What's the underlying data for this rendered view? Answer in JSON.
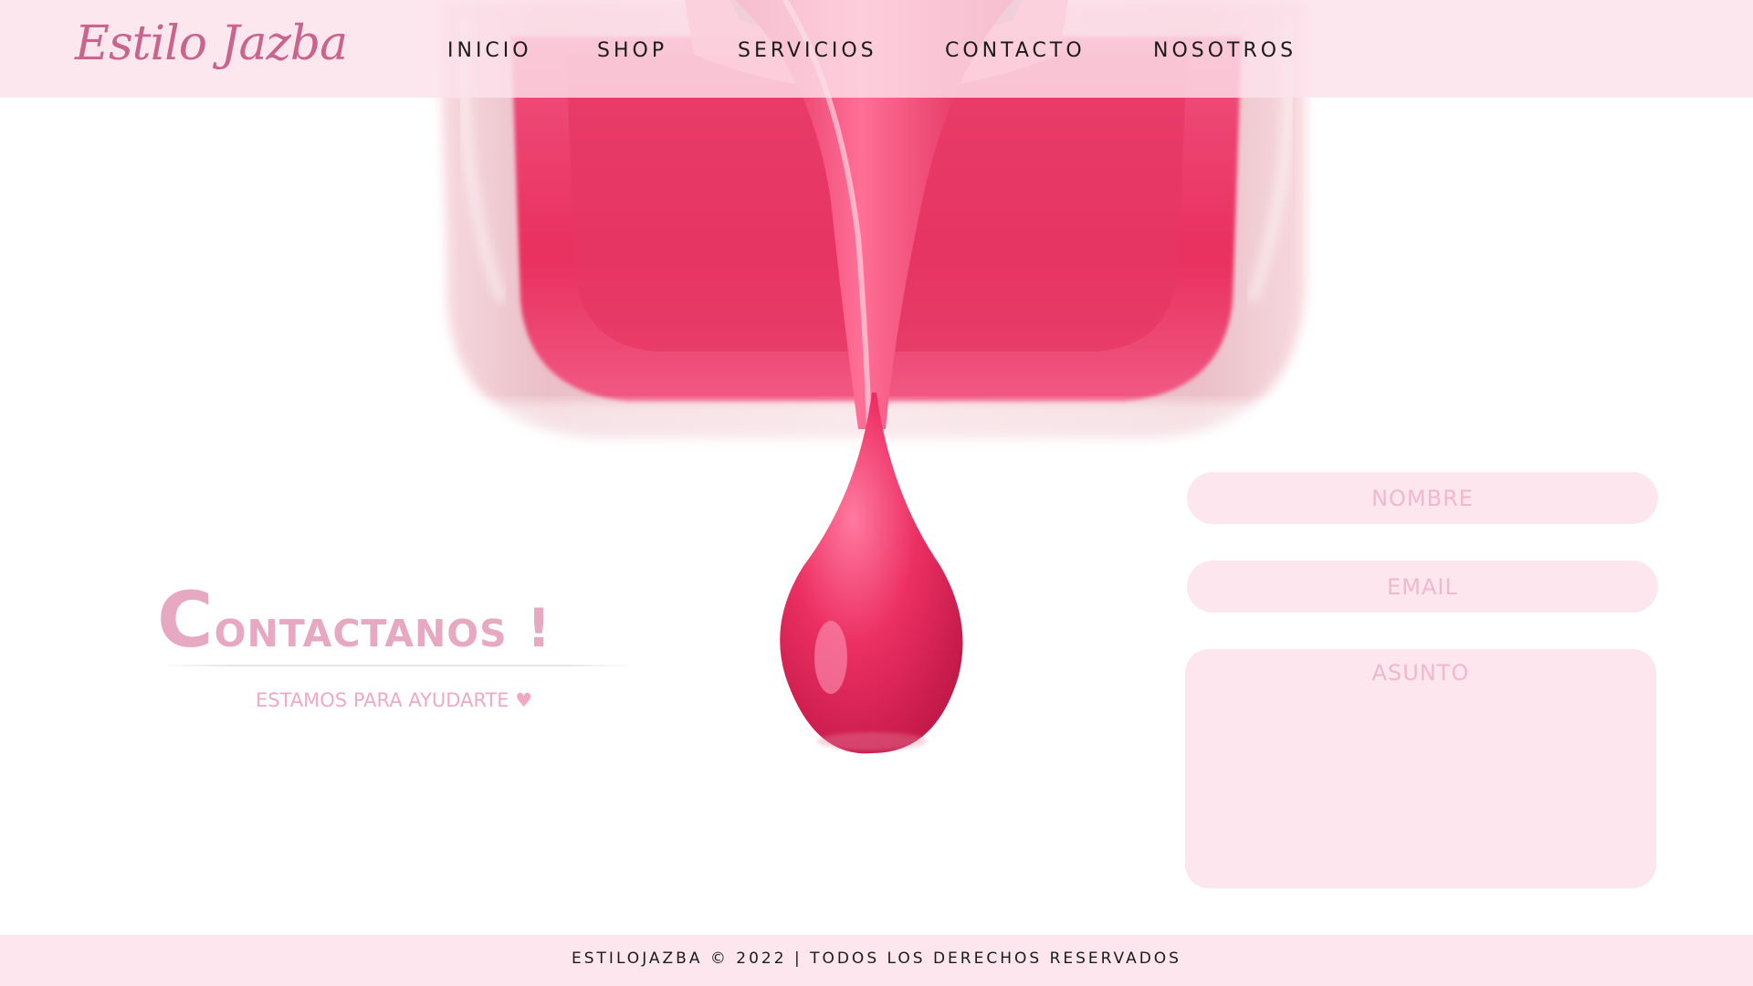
{
  "brand": {
    "logo_text": "Estilo Jazba"
  },
  "nav": {
    "items": [
      {
        "label": "INICIO"
      },
      {
        "label": "SHOP"
      },
      {
        "label": "SERVICIOS"
      },
      {
        "label": "CONTACTO"
      },
      {
        "label": "NOSOTROS"
      }
    ]
  },
  "hero": {
    "image_icon": "nail-polish-drip-icon"
  },
  "contact": {
    "title_first_letter": "C",
    "title_rest": "ontactanos !",
    "subtitle": "ESTAMOS PARA AYUDARTE ♥"
  },
  "form": {
    "name_placeholder": "NOMBRE",
    "email_placeholder": "EMAIL",
    "subject_placeholder": "ASUNTO"
  },
  "footer": {
    "text": "ESTILOJAZBA © 2022 | TODOS LOS DERECHOS RESERVADOS"
  },
  "colors": {
    "accent_pink": "#e9356a",
    "soft_pink": "#fde6ee",
    "title_pink": "#e7a9c1",
    "logo_pink": "#c9658c"
  }
}
